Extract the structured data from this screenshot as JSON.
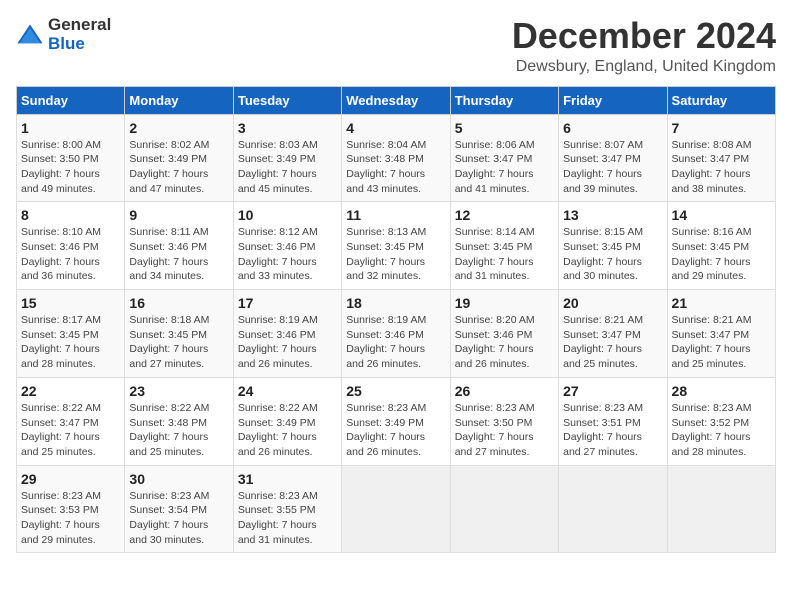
{
  "logo": {
    "general": "General",
    "blue": "Blue"
  },
  "title": "December 2024",
  "location": "Dewsbury, England, United Kingdom",
  "days_of_week": [
    "Sunday",
    "Monday",
    "Tuesday",
    "Wednesday",
    "Thursday",
    "Friday",
    "Saturday"
  ],
  "weeks": [
    [
      {
        "day": "1",
        "sunrise": "8:00 AM",
        "sunset": "3:50 PM",
        "daylight": "7 hours and 49 minutes."
      },
      {
        "day": "2",
        "sunrise": "8:02 AM",
        "sunset": "3:49 PM",
        "daylight": "7 hours and 47 minutes."
      },
      {
        "day": "3",
        "sunrise": "8:03 AM",
        "sunset": "3:49 PM",
        "daylight": "7 hours and 45 minutes."
      },
      {
        "day": "4",
        "sunrise": "8:04 AM",
        "sunset": "3:48 PM",
        "daylight": "7 hours and 43 minutes."
      },
      {
        "day": "5",
        "sunrise": "8:06 AM",
        "sunset": "3:47 PM",
        "daylight": "7 hours and 41 minutes."
      },
      {
        "day": "6",
        "sunrise": "8:07 AM",
        "sunset": "3:47 PM",
        "daylight": "7 hours and 39 minutes."
      },
      {
        "day": "7",
        "sunrise": "8:08 AM",
        "sunset": "3:47 PM",
        "daylight": "7 hours and 38 minutes."
      }
    ],
    [
      {
        "day": "8",
        "sunrise": "8:10 AM",
        "sunset": "3:46 PM",
        "daylight": "7 hours and 36 minutes."
      },
      {
        "day": "9",
        "sunrise": "8:11 AM",
        "sunset": "3:46 PM",
        "daylight": "7 hours and 34 minutes."
      },
      {
        "day": "10",
        "sunrise": "8:12 AM",
        "sunset": "3:46 PM",
        "daylight": "7 hours and 33 minutes."
      },
      {
        "day": "11",
        "sunrise": "8:13 AM",
        "sunset": "3:45 PM",
        "daylight": "7 hours and 32 minutes."
      },
      {
        "day": "12",
        "sunrise": "8:14 AM",
        "sunset": "3:45 PM",
        "daylight": "7 hours and 31 minutes."
      },
      {
        "day": "13",
        "sunrise": "8:15 AM",
        "sunset": "3:45 PM",
        "daylight": "7 hours and 30 minutes."
      },
      {
        "day": "14",
        "sunrise": "8:16 AM",
        "sunset": "3:45 PM",
        "daylight": "7 hours and 29 minutes."
      }
    ],
    [
      {
        "day": "15",
        "sunrise": "8:17 AM",
        "sunset": "3:45 PM",
        "daylight": "7 hours and 28 minutes."
      },
      {
        "day": "16",
        "sunrise": "8:18 AM",
        "sunset": "3:45 PM",
        "daylight": "7 hours and 27 minutes."
      },
      {
        "day": "17",
        "sunrise": "8:19 AM",
        "sunset": "3:46 PM",
        "daylight": "7 hours and 26 minutes."
      },
      {
        "day": "18",
        "sunrise": "8:19 AM",
        "sunset": "3:46 PM",
        "daylight": "7 hours and 26 minutes."
      },
      {
        "day": "19",
        "sunrise": "8:20 AM",
        "sunset": "3:46 PM",
        "daylight": "7 hours and 26 minutes."
      },
      {
        "day": "20",
        "sunrise": "8:21 AM",
        "sunset": "3:47 PM",
        "daylight": "7 hours and 25 minutes."
      },
      {
        "day": "21",
        "sunrise": "8:21 AM",
        "sunset": "3:47 PM",
        "daylight": "7 hours and 25 minutes."
      }
    ],
    [
      {
        "day": "22",
        "sunrise": "8:22 AM",
        "sunset": "3:47 PM",
        "daylight": "7 hours and 25 minutes."
      },
      {
        "day": "23",
        "sunrise": "8:22 AM",
        "sunset": "3:48 PM",
        "daylight": "7 hours and 25 minutes."
      },
      {
        "day": "24",
        "sunrise": "8:22 AM",
        "sunset": "3:49 PM",
        "daylight": "7 hours and 26 minutes."
      },
      {
        "day": "25",
        "sunrise": "8:23 AM",
        "sunset": "3:49 PM",
        "daylight": "7 hours and 26 minutes."
      },
      {
        "day": "26",
        "sunrise": "8:23 AM",
        "sunset": "3:50 PM",
        "daylight": "7 hours and 27 minutes."
      },
      {
        "day": "27",
        "sunrise": "8:23 AM",
        "sunset": "3:51 PM",
        "daylight": "7 hours and 27 minutes."
      },
      {
        "day": "28",
        "sunrise": "8:23 AM",
        "sunset": "3:52 PM",
        "daylight": "7 hours and 28 minutes."
      }
    ],
    [
      {
        "day": "29",
        "sunrise": "8:23 AM",
        "sunset": "3:53 PM",
        "daylight": "7 hours and 29 minutes."
      },
      {
        "day": "30",
        "sunrise": "8:23 AM",
        "sunset": "3:54 PM",
        "daylight": "7 hours and 30 minutes."
      },
      {
        "day": "31",
        "sunrise": "8:23 AM",
        "sunset": "3:55 PM",
        "daylight": "7 hours and 31 minutes."
      },
      null,
      null,
      null,
      null
    ]
  ],
  "labels": {
    "sunrise": "Sunrise:",
    "sunset": "Sunset:",
    "daylight": "Daylight:"
  }
}
